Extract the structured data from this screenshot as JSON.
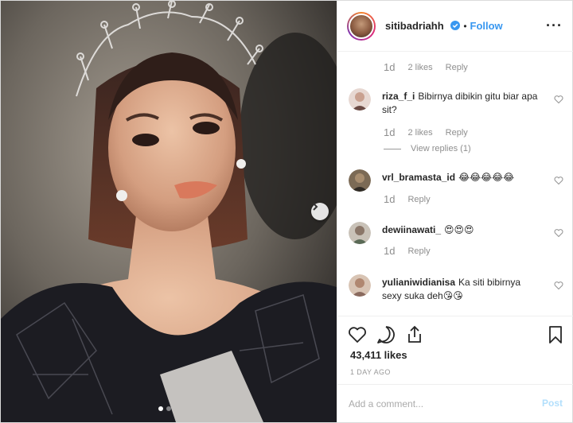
{
  "post": {
    "username": "sitibadriahh",
    "verified": true,
    "separator": "•",
    "follow_label": "Follow",
    "more_label": "···"
  },
  "comments": [
    {
      "type": "meta",
      "time": "1d",
      "likes": "2 likes",
      "reply": "Reply"
    },
    {
      "type": "comment",
      "username": "riza_f_i",
      "text": "Bibirnya dibikin gitu biar apa sit?",
      "time": "1d",
      "likes": "2 likes",
      "reply": "Reply",
      "view_replies": "View replies (1)"
    },
    {
      "type": "comment",
      "username": "vrl_bramasta_id",
      "text": "😂😂😂😂😂",
      "time": "1d",
      "reply": "Reply"
    },
    {
      "type": "comment",
      "username": "dewiinawati_",
      "text": "😍😍😍",
      "time": "1d",
      "reply": "Reply"
    },
    {
      "type": "comment",
      "username": "yulianiwidianisa",
      "text": "Ka siti bibirnya sexy suka deh😘😘"
    }
  ],
  "likes": "43,411 likes",
  "time_ago": "1 DAY AGO",
  "add_comment": {
    "placeholder": "Add a comment...",
    "post_label": "Post"
  },
  "icons": {
    "next": "chevron-right-icon",
    "like": "heart-icon",
    "comment": "speech-bubble-icon",
    "share": "share-icon",
    "save": "bookmark-icon"
  },
  "colors": {
    "accent": "#3897f0",
    "post_disabled": "#b2dffc",
    "muted": "#8e8e8e"
  },
  "carousel": {
    "slides": 2,
    "active": 1
  }
}
